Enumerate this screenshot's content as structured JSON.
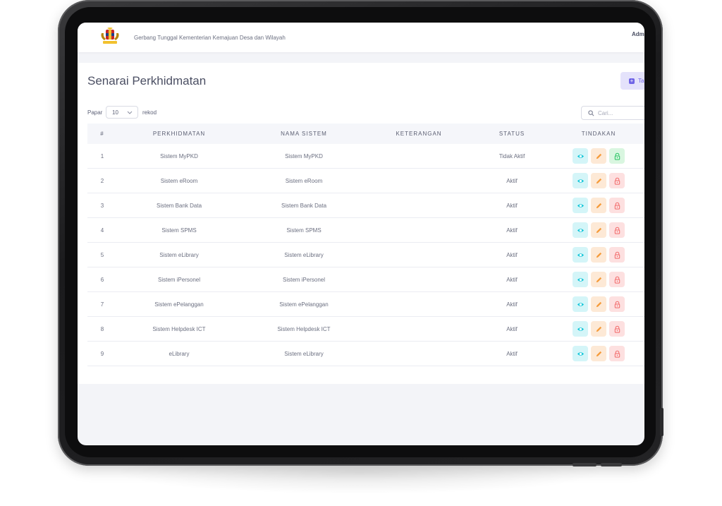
{
  "header": {
    "portal_title": "Gerbang Tunggal Kementerian Kemajuan Desa dan Wilayah",
    "user_name": "Adm"
  },
  "page": {
    "title": "Senarai Perkhidmatan",
    "add_button_label": "Ta"
  },
  "table_controls": {
    "show_label": "Papar",
    "page_length": "10",
    "records_label": "rekod",
    "search_placeholder": "Cari..."
  },
  "table": {
    "columns": [
      "#",
      "PERKHIDMATAN",
      "NAMA SISTEM",
      "KETERANGAN",
      "STATUS",
      "TINDAKAN"
    ],
    "rows": [
      {
        "no": "1",
        "service": "Sistem MyPKD",
        "system": "Sistem MyPKD",
        "description": "",
        "status": "Tidak Aktif",
        "lock": "unlocked"
      },
      {
        "no": "2",
        "service": "Sistem eRoom",
        "system": "Sistem eRoom",
        "description": "",
        "status": "Aktif",
        "lock": "locked"
      },
      {
        "no": "3",
        "service": "Sistem Bank Data",
        "system": "Sistem Bank Data",
        "description": "",
        "status": "Aktif",
        "lock": "locked"
      },
      {
        "no": "4",
        "service": "Sistem SPMS",
        "system": "Sistem SPMS",
        "description": "",
        "status": "Aktif",
        "lock": "locked"
      },
      {
        "no": "5",
        "service": "Sistem eLibrary",
        "system": "Sistem eLibrary",
        "description": "",
        "status": "Aktif",
        "lock": "locked"
      },
      {
        "no": "6",
        "service": "Sistem iPersonel",
        "system": "Sistem iPersonel",
        "description": "",
        "status": "Aktif",
        "lock": "locked"
      },
      {
        "no": "7",
        "service": "Sistem ePelanggan",
        "system": "Sistem ePelanggan",
        "description": "",
        "status": "Aktif",
        "lock": "locked"
      },
      {
        "no": "8",
        "service": "Sistem Helpdesk ICT",
        "system": "Sistem Helpdesk ICT",
        "description": "",
        "status": "Aktif",
        "lock": "locked"
      },
      {
        "no": "9",
        "service": "eLibrary",
        "system": "Sistem eLibrary",
        "description": "",
        "status": "Aktif",
        "lock": "locked"
      }
    ]
  },
  "icons": {
    "view": "eye-icon",
    "edit": "pencil-icon",
    "lock": "lock-icon",
    "search": "search-icon",
    "add": "plus-icon",
    "logo": "coat-of-arms-logo"
  },
  "colors": {
    "accent": "#6f64e6",
    "view": "#13c6d9",
    "edit": "#f59b3a",
    "active_lock": "#22c35e",
    "inactive_lock": "#f26868"
  }
}
